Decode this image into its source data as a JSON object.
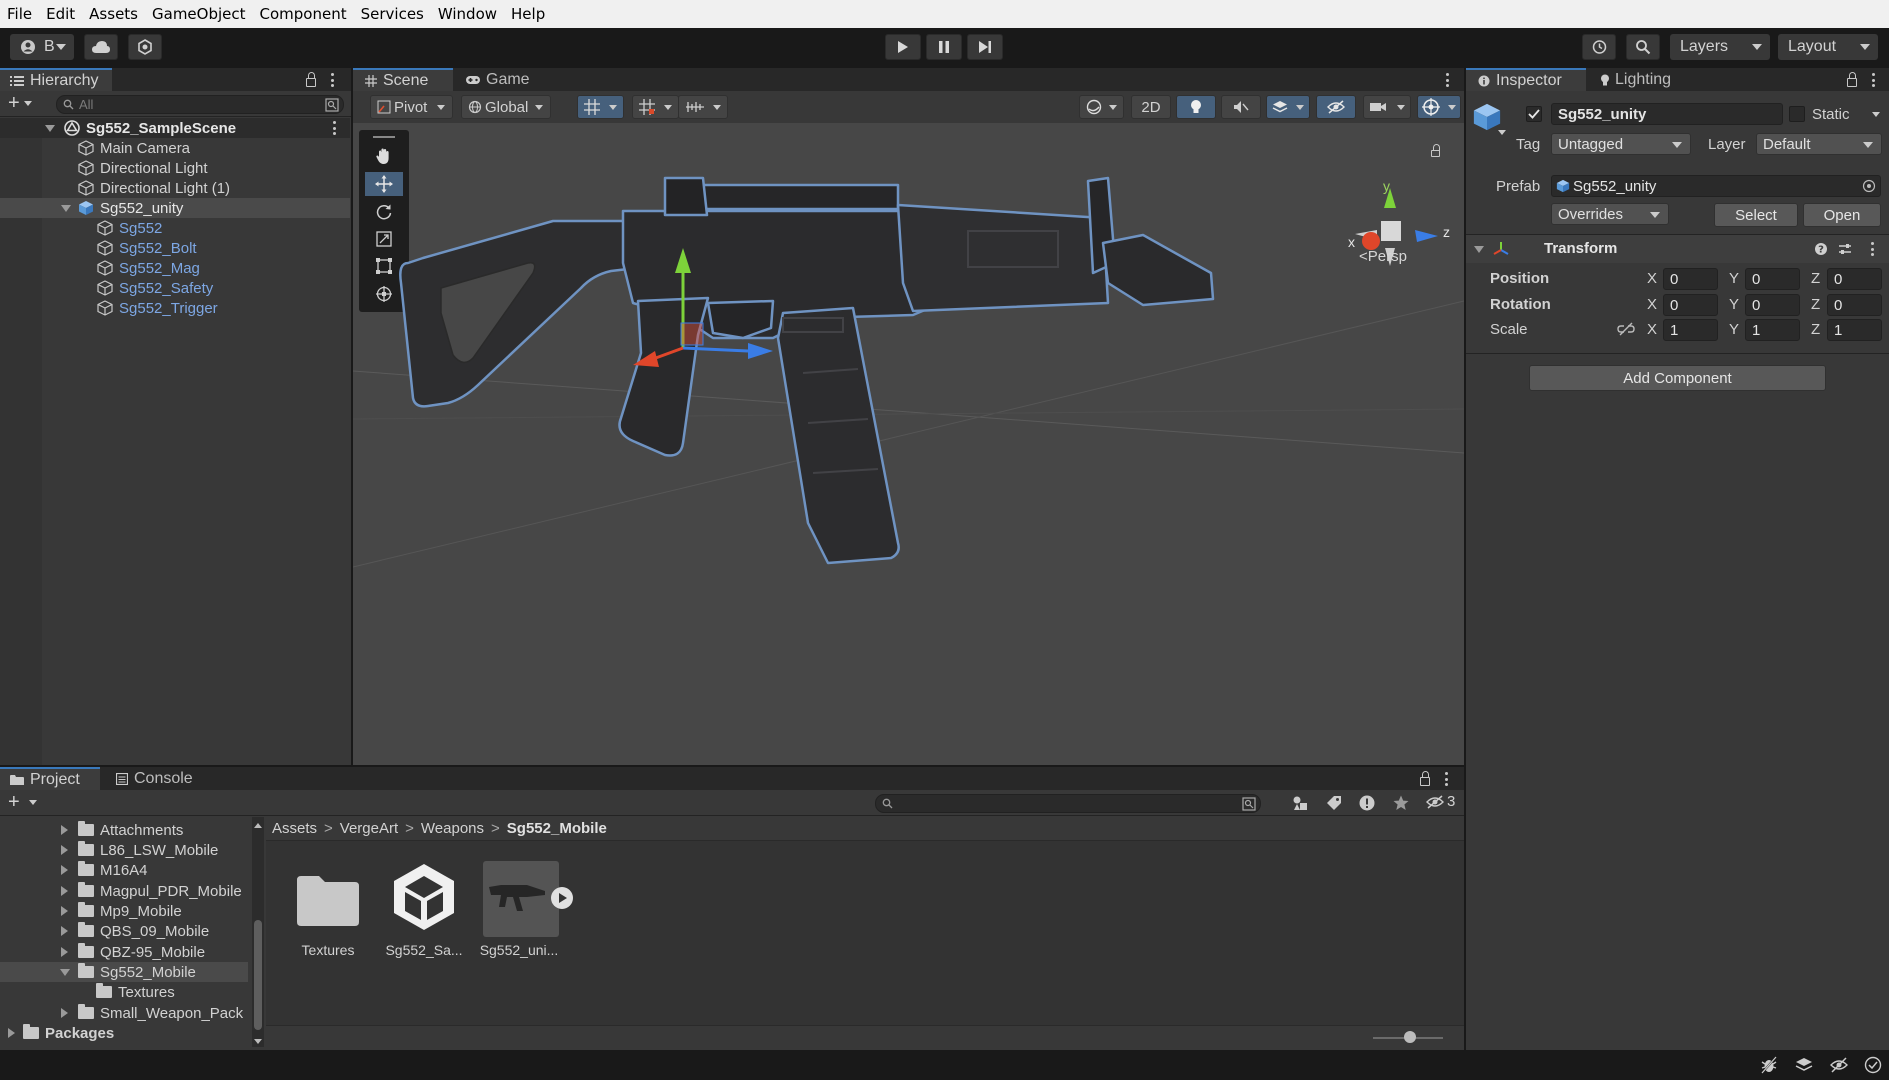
{
  "menu": [
    "File",
    "Edit",
    "Assets",
    "GameObject",
    "Component",
    "Services",
    "Window",
    "Help"
  ],
  "toolbar": {
    "account_label": "B",
    "layers_label": "Layers",
    "layout_label": "Layout"
  },
  "hierarchy": {
    "tab_label": "Hierarchy",
    "search_placeholder": "All",
    "scene_name": "Sg552_SampleScene",
    "items": [
      {
        "label": "Main Camera"
      },
      {
        "label": "Directional Light"
      },
      {
        "label": "Directional Light (1)"
      },
      {
        "label": "Sg552_unity"
      },
      {
        "label": "Sg552"
      },
      {
        "label": "Sg552_Bolt"
      },
      {
        "label": "Sg552_Mag"
      },
      {
        "label": "Sg552_Safety"
      },
      {
        "label": "Sg552_Trigger"
      }
    ]
  },
  "scene": {
    "tabs": [
      "Scene",
      "Game"
    ],
    "pivot_label": "Pivot",
    "global_label": "Global",
    "mode_2d": "2D",
    "persp_label": "Persp",
    "gizmo_axes": {
      "x": "x",
      "y": "y",
      "z": "z"
    }
  },
  "inspector": {
    "tabs": [
      "Inspector",
      "Lighting"
    ],
    "object_name": "Sg552_unity",
    "static_label": "Static",
    "tag_label": "Tag",
    "tag_value": "Untagged",
    "layer_label": "Layer",
    "layer_value": "Default",
    "prefab_label": "Prefab",
    "prefab_value": "Sg552_unity",
    "overrides_label": "Overrides",
    "select_label": "Select",
    "open_label": "Open",
    "transform_title": "Transform",
    "position_label": "Position",
    "rotation_label": "Rotation",
    "scale_label": "Scale",
    "position": {
      "x": "0",
      "y": "0",
      "z": "0"
    },
    "rotation": {
      "x": "0",
      "y": "0",
      "z": "0"
    },
    "scale": {
      "x": "1",
      "y": "1",
      "z": "1"
    },
    "add_component_label": "Add Component"
  },
  "project": {
    "tabs": [
      "Project",
      "Console"
    ],
    "hidden_count": "3",
    "tree": [
      {
        "label": "Attachments"
      },
      {
        "label": "L86_LSW_Mobile"
      },
      {
        "label": "M16A4"
      },
      {
        "label": "Magpul_PDR_Mobile"
      },
      {
        "label": "Mp9_Mobile"
      },
      {
        "label": "QBS_09_Mobile"
      },
      {
        "label": "QBZ-95_Mobile"
      },
      {
        "label": "Sg552_Mobile"
      },
      {
        "label": "Textures"
      },
      {
        "label": "Small_Weapon_Pack"
      },
      {
        "label": "Packages"
      }
    ],
    "breadcrumb": [
      "Assets",
      "VergeArt",
      "Weapons",
      "Sg552_Mobile"
    ],
    "assets": [
      {
        "label": "Textures"
      },
      {
        "label": "Sg552_Sa..."
      },
      {
        "label": "Sg552_uni..."
      }
    ]
  }
}
